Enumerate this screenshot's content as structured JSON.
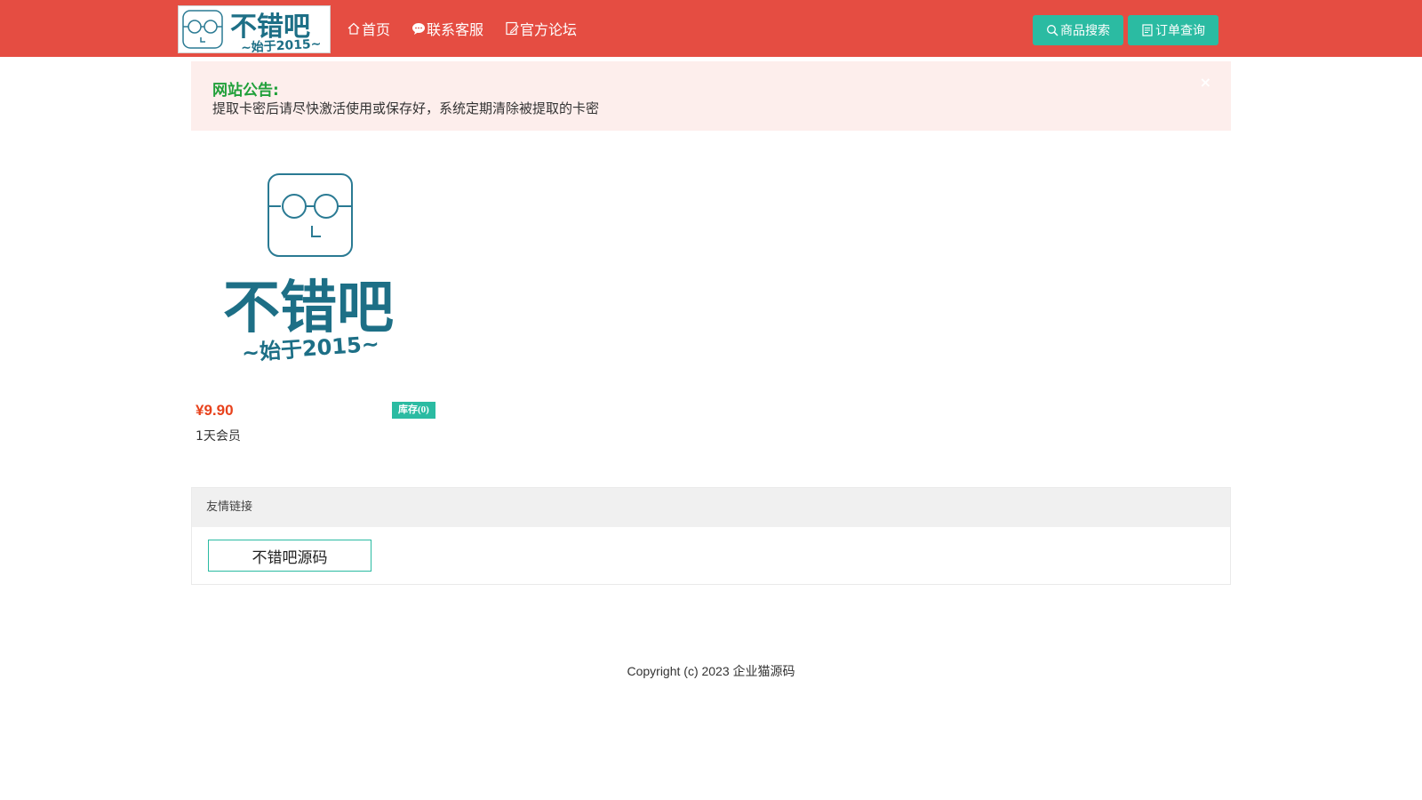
{
  "header": {
    "logo": {
      "brand": "不错吧",
      "since": "~始于2015~"
    },
    "nav": [
      {
        "label": "首页",
        "icon": "home-icon"
      },
      {
        "label": "联系客服",
        "icon": "chat-icon"
      },
      {
        "label": "官方论坛",
        "icon": "forum-icon"
      }
    ],
    "search_button": "商品搜索",
    "order_button": "订单查询"
  },
  "notice": {
    "title": "网站公告:",
    "text": "提取卡密后请尽快激活使用或保存好，系统定期清除被提取的卡密",
    "close": "×"
  },
  "products": [
    {
      "brand": "不错吧",
      "since": "~始于2015~",
      "price": "¥9.90",
      "stock": "库存(0)",
      "name": "1天会员"
    }
  ],
  "links": {
    "title": "友情链接",
    "items": [
      "不错吧源码"
    ]
  },
  "footer": {
    "copyright": "Copyright (c) 2023 企业猫源码"
  },
  "colors": {
    "header": "#e54d42",
    "accent": "#2bbba2",
    "price": "#e8421c",
    "notice_title": "#20a03a",
    "brand": "#1d6f86"
  }
}
